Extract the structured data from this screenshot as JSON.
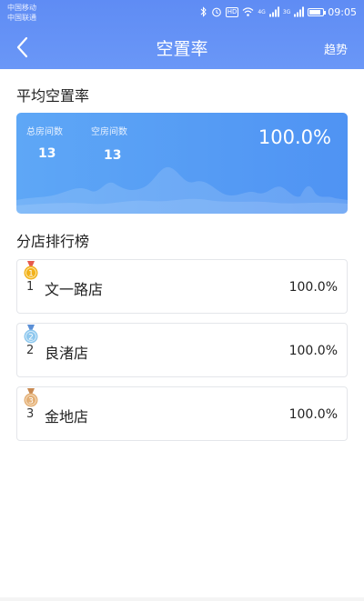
{
  "status_bar": {
    "carrier_1": "中国移动",
    "carrier_2": "中国联通",
    "hd_badge": "HD",
    "signal_1_tag": "4G",
    "signal_2_tag": "3G",
    "time": "09:05"
  },
  "header": {
    "title": "空置率",
    "trend_label": "趋势",
    "background_color": "#6a97f7"
  },
  "average_section": {
    "title": "平均空置率",
    "card": {
      "total_rooms_label": "总房间数",
      "total_rooms_value": "13",
      "empty_rooms_label": "空房间数",
      "empty_rooms_value": "13",
      "vacancy_rate": "100.0%"
    }
  },
  "ranking_section": {
    "title": "分店排行榜",
    "items": [
      {
        "medal_label": "1",
        "rank": "1",
        "name": "文一路店",
        "rate": "100.0%",
        "medal_color": "#f2b21c"
      },
      {
        "medal_label": "2",
        "rank": "2",
        "name": "良渚店",
        "rate": "100.0%",
        "medal_color": "#8fc8ee"
      },
      {
        "medal_label": "3",
        "rank": "3",
        "name": "金地店",
        "rate": "100.0%",
        "medal_color": "#e3b077"
      }
    ]
  }
}
